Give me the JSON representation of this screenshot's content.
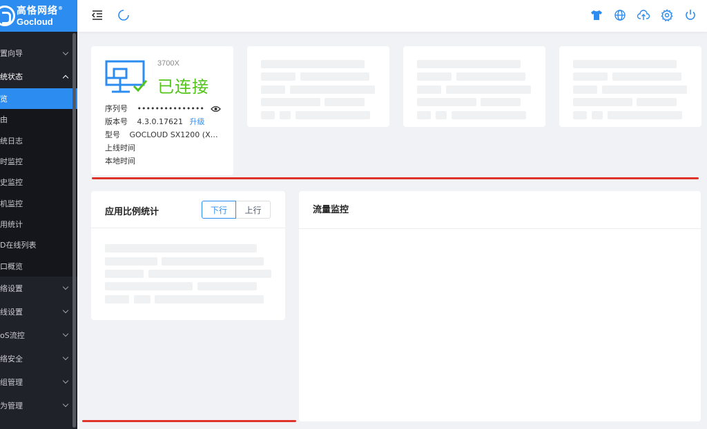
{
  "brand": {
    "name_cn": "高恪网络",
    "name_en": "Gocloud",
    "reg_mark": "®"
  },
  "sidebar": {
    "groups": [
      {
        "label": "置向导",
        "open": false
      },
      {
        "label": "统状态",
        "open": true,
        "items": [
          "览",
          "由",
          "统日志",
          "时监控",
          "史监控",
          "机监控",
          "用统计",
          "D在线列表",
          "口概览"
        ]
      },
      {
        "label": "络设置",
        "open": false
      },
      {
        "label": "线设置",
        "open": false
      },
      {
        "label": "oS流控",
        "open": false
      },
      {
        "label": "络安全",
        "open": false
      },
      {
        "label": "组管理",
        "open": false
      },
      {
        "label": "为管理",
        "open": false
      }
    ]
  },
  "header": {
    "icons": [
      "menu-collapse-icon",
      "refresh-icon"
    ],
    "right_icons": [
      "tshirt-icon",
      "globe-icon",
      "cloud-upload-icon",
      "settings-icon",
      "power-icon"
    ],
    "icon_color": "#2d8cf0"
  },
  "device": {
    "model": "3700X",
    "status": "已连接",
    "status_color": "#52c41a",
    "serial_label": "序列号",
    "serial_value": "•••••••••••••••",
    "version_label": "版本号",
    "version_value": "4.3.0.17621",
    "upgrade_label": "升级",
    "type_label": "型号",
    "type_value": "GOCLOUD SX1200 (X…",
    "online_time_label": "上线时间",
    "local_time_label": "本地时间"
  },
  "ratio_panel": {
    "title": "应用比例统计",
    "toggle": {
      "down_label": "下行",
      "up_label": "上行",
      "selected": "下行"
    }
  },
  "traffic_panel": {
    "title": "流量监控"
  },
  "colors": {
    "accent": "#2d8cf0",
    "sidebar_bg": "#20222a",
    "annotation_red": "#e0332a"
  }
}
